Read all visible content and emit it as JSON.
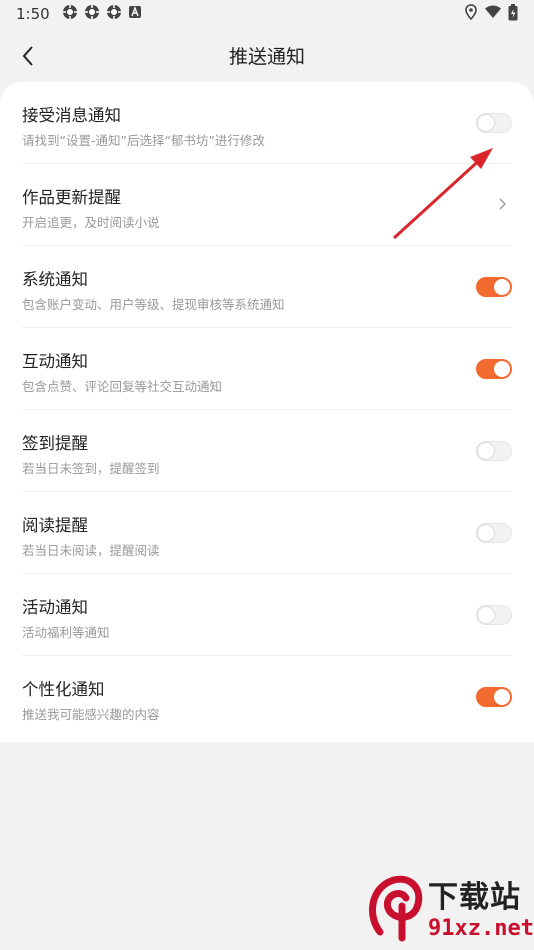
{
  "status_bar": {
    "time": "1:50",
    "left_icons": [
      "gear-icon",
      "gear-icon",
      "gear-icon",
      "text-a-icon"
    ],
    "right_icons": [
      "location-icon",
      "wifi-icon",
      "battery-icon"
    ]
  },
  "header": {
    "title": "推送通知",
    "back_icon": "chevron-left-icon"
  },
  "settings": {
    "items": [
      {
        "title": "接受消息通知",
        "subtitle": "请找到“设置-通知”后选择“郁书坊”进行修改",
        "control": "toggle",
        "on": false
      },
      {
        "title": "作品更新提醒",
        "subtitle": "开启追更，及时阅读小说",
        "control": "chevron",
        "on": null
      },
      {
        "title": "系统通知",
        "subtitle": "包含账户变动、用户等级、提现审核等系统通知",
        "control": "toggle",
        "on": true
      },
      {
        "title": "互动通知",
        "subtitle": "包含点赞、评论回复等社交互动通知",
        "control": "toggle",
        "on": true
      },
      {
        "title": "签到提醒",
        "subtitle": "若当日未签到，提醒签到",
        "control": "toggle",
        "on": false
      },
      {
        "title": "阅读提醒",
        "subtitle": "若当日未阅读，提醒阅读",
        "control": "toggle",
        "on": false
      },
      {
        "title": "活动通知",
        "subtitle": "活动福利等通知",
        "control": "toggle",
        "on": false
      },
      {
        "title": "个性化通知",
        "subtitle": "推送我可能感兴趣的内容",
        "control": "toggle",
        "on": true
      }
    ]
  },
  "colors": {
    "accent": "#f26a2e",
    "annotation_arrow": "#d9262c",
    "background": "#f2f2f2"
  },
  "watermark": {
    "top_text": "下载站",
    "bottom_text": "91xz.net"
  }
}
